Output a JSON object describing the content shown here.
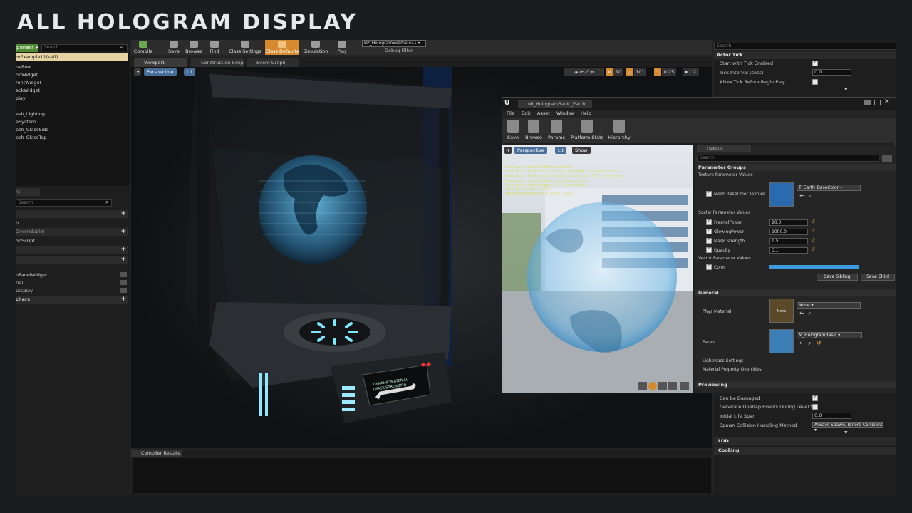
{
  "banner": {
    "title": "ALL HOLOGRAM DISPLAY"
  },
  "components": {
    "add_label": "ponent ▾",
    "search_placeholder": "Search",
    "selected": "mExample11(self)",
    "items": [
      "neRoot",
      "onWidget",
      "rontWidget",
      "ackWidget",
      "play",
      "",
      "esh_Lighting",
      "eSystem",
      "esh_GlassSide",
      "esh_GlassTop"
    ]
  },
  "my_blueprint": {
    "tab": "nt",
    "search_placeholder": "Search",
    "rows": [
      {
        "type": "header",
        "label": ""
      },
      {
        "type": "item",
        "label": "h"
      },
      {
        "type": "header",
        "label": "Overridable)"
      },
      {
        "type": "item",
        "label": "onScript"
      },
      {
        "type": "header",
        "label": ""
      },
      {
        "type": "header",
        "label": ""
      },
      {
        "type": "item",
        "label": "nPanelWidget"
      },
      {
        "type": "item",
        "label": "rial"
      },
      {
        "type": "item",
        "label": "Display"
      },
      {
        "type": "header",
        "label": "chers"
      }
    ]
  },
  "toolbar": {
    "buttons": [
      "Compile",
      "Save",
      "Browse",
      "Find",
      "Class Settings",
      "Class Defaults",
      "Simulation",
      "Play"
    ],
    "debug_object": "BP_HologramExample11 ▾",
    "debug_filter": "Debug Filter"
  },
  "editor_tabs": [
    "Viewport",
    "Construction Scrip",
    "Event Graph"
  ],
  "viewport": {
    "perspective": "Perspective",
    "lit": "Lit",
    "grid": "10",
    "angle": "10°",
    "scale": "0.25",
    "camera": "2",
    "panel_text": [
      "DYNAMIC MATERIAL",
      "(MASK STRENGTH)"
    ]
  },
  "compiler": {
    "tab": "Compiler Results"
  },
  "details": {
    "search_placeholder": "Search",
    "actor_tick": "Actor Tick",
    "start_tick": "Start with Tick Enabled",
    "tick_interval": "Tick Interval (secs)",
    "tick_interval_value": "0.0",
    "allow_tick": "Allow Tick Before Begin Play",
    "can_damage": "Can be Damaged",
    "overlap": "Generate Overlap Events During Level S",
    "life_span": "Initial Life Span",
    "life_span_value": "0.0",
    "spawn": "Spawn Collision Handling Method",
    "spawn_value": "Always Spawn, Ignore Collisions ▾",
    "lod": "LOD",
    "cooking": "Cooking"
  },
  "material_editor": {
    "tab": "MI_HologramBasic_Earth",
    "menu": [
      "File",
      "Edit",
      "Asset",
      "Window",
      "Help"
    ],
    "tools": [
      "Save",
      "Browse",
      "Params",
      "Platform Stats",
      "Hierarchy"
    ],
    "preview": {
      "perspective": "Perspective",
      "lit": "Lit",
      "show": "Show",
      "stats": [
        "Base pass shader: 195 instructions",
        "Base pass shader with Surface Lightmap: 137 instructions",
        "Base pass shader with Volumetric Lightmap: 195 instructions",
        "Base pass vertex shader: 111 instructions",
        "Base pass vertex shader: 103 instructions",
        "Texture samplers: 5/16",
        "Texture Lookups (Est.): VS(0), PS(2)"
      ]
    },
    "details_tab": "Details",
    "search_placeholder": "Search",
    "parameter_groups": "Parameter Groups",
    "texture_params": "Texture Parameter Values",
    "texture_label": "Mesh BaseColor Texture",
    "texture_value": "T_Earth_BaseColor ▾",
    "scalar_params": "Scalar Parameter Values",
    "scalars": [
      {
        "name": "FresnelPower",
        "value": "20.0"
      },
      {
        "name": "GlowingPower",
        "value": "1000.0"
      },
      {
        "name": "Mask Strength",
        "value": "1.5"
      },
      {
        "name": "Opacity",
        "value": "0.1"
      }
    ],
    "vector_params": "Vector Parameter Values",
    "color_label": "Color",
    "save_sibling": "Save Sibling",
    "save_child": "Save Child",
    "general": "General",
    "phys_material": "Phys Material",
    "phys_value": "None ▾",
    "phys_thumb": "None",
    "parent": "Parent",
    "parent_value": "M_HologramBasic ▾",
    "lightmass": "Lightmass Settings",
    "overrides": "Material Property Overrides",
    "previewing": "Previewing"
  },
  "colors": {
    "accent": "#d58a2f",
    "hologram": "#5fc8ff",
    "add_button": "#4d8b2c"
  }
}
